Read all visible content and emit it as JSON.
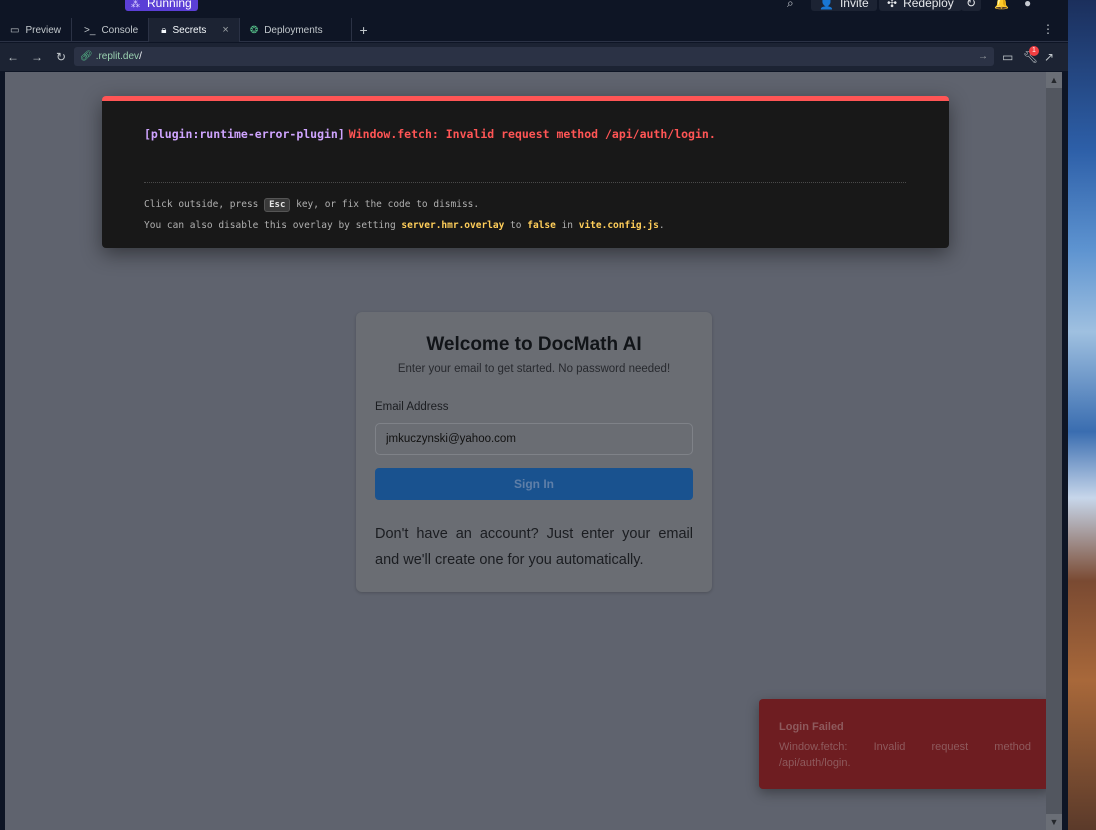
{
  "header": {
    "status_label": "Running",
    "invite_label": "Invite",
    "redeploy_label": "Redeploy"
  },
  "tabs": [
    {
      "label": "Preview",
      "icon": "monitor-icon",
      "active": false
    },
    {
      "label": "Console",
      "icon": "terminal-icon",
      "active": false
    },
    {
      "label": "Secrets",
      "icon": "lock-icon",
      "active": true,
      "closable": true
    },
    {
      "label": "Deployments",
      "icon": "deploy-icon",
      "active": false
    }
  ],
  "urlbar": {
    "url_host": ".replit.dev",
    "url_path": "/",
    "notification_count": "1"
  },
  "error_overlay": {
    "plugin": "[plugin:runtime-error-plugin]",
    "message": "Window.fetch: Invalid request method /api/auth/login.",
    "tip1_pre": "Click outside, press ",
    "tip1_key": "Esc",
    "tip1_post": " key, or fix the code to dismiss.",
    "tip2_a": "You can also disable this overlay by setting ",
    "tip2_code1": "server.hmr.overlay",
    "tip2_b": " to ",
    "tip2_code2": "false",
    "tip2_c": " in ",
    "tip2_code3": "vite.config.js",
    "tip2_d": "."
  },
  "login": {
    "title": "Welcome to DocMath AI",
    "subtitle": "Enter your email to get started. No password needed!",
    "email_label": "Email Address",
    "email_value": "jmkuczynski@yahoo.com",
    "signin_label": "Sign In",
    "footer": "Don't have an account? Just enter your email and we'll create one for you automatically."
  },
  "toast": {
    "title": "Login Failed",
    "body": "Window.fetch: Invalid request method /api/auth/login."
  },
  "colors": {
    "overlay_accent": "#ff5555",
    "plugin_text": "#cfa4ff",
    "code_text": "#ffce5a",
    "signin_button": "#19528f",
    "toast_bg": "#6e1d21",
    "running_pill": "#5b3fd6"
  }
}
